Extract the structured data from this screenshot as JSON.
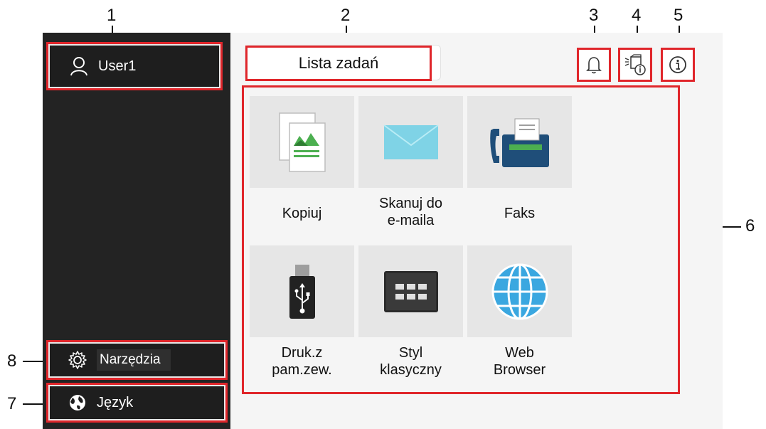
{
  "callouts": {
    "c1": "1",
    "c2": "2",
    "c3": "3",
    "c4": "4",
    "c5": "5",
    "c6": "6",
    "c7": "7",
    "c8": "8"
  },
  "sidebar": {
    "user_label": "User1",
    "tools_label": "Narzędzia",
    "language_label": "Język"
  },
  "header": {
    "job_list_label": "Lista zadań",
    "icons": [
      "bell-icon",
      "device-info-icon",
      "info-icon"
    ]
  },
  "apps": [
    {
      "label": "Kopiuj",
      "icon": "copy-icon"
    },
    {
      "label": "Skanuj do\ne-maila",
      "icon": "email-icon"
    },
    {
      "label": "Faks",
      "icon": "fax-icon"
    },
    {
      "label": "Druk.z\npam.zew.",
      "icon": "usb-icon"
    },
    {
      "label": "Styl\nklasyczny",
      "icon": "keypad-icon"
    },
    {
      "label": "Web\nBrowser",
      "icon": "globe-icon"
    }
  ],
  "colors": {
    "highlight": "#e0262b",
    "sidebar": "#232323",
    "tile": "#e6e6e6",
    "email": "#7fd3e6",
    "fax": "#1f4e79",
    "globe": "#3aa7e0"
  }
}
